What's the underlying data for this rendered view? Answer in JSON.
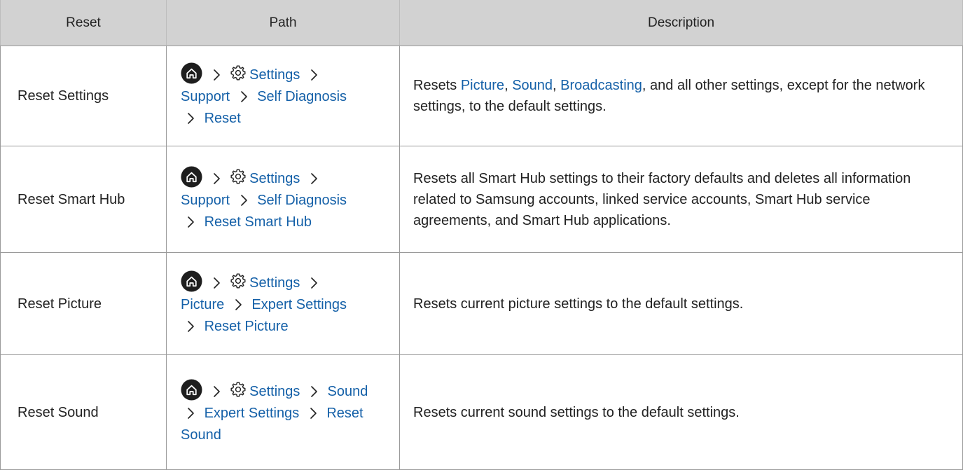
{
  "headers": {
    "reset": "Reset",
    "path": "Path",
    "description": "Description"
  },
  "icons": {
    "home": "home-icon",
    "settings": "gear-icon",
    "separator": "chevron-right-icon"
  },
  "colors": {
    "link": "#1460a8",
    "header_bg": "#d2d2d2",
    "icon_fill": "#1e1e1e"
  },
  "rows": [
    {
      "reset": "Reset Settings",
      "path": {
        "settings": "Settings",
        "p1": "Support",
        "p2": "Self Diagnosis",
        "p3": "Reset"
      },
      "desc": {
        "t1": "Resets ",
        "l1": "Picture",
        "t2": ", ",
        "l2": "Sound",
        "t3": ", ",
        "l3": "Broadcasting",
        "t4": ", and all other settings, except for the network settings, to the default settings."
      }
    },
    {
      "reset": "Reset Smart Hub",
      "path": {
        "settings": "Settings",
        "p1": "Support",
        "p2": "Self Diagnosis",
        "p3": "Reset Smart Hub"
      },
      "desc": "Resets all Smart Hub settings to their factory defaults and deletes all information related to Samsung accounts, linked service accounts, Smart Hub service agreements, and Smart Hub applications."
    },
    {
      "reset": "Reset Picture",
      "path": {
        "settings": "Settings",
        "p1": "Picture",
        "p2": "Expert Settings",
        "p3": "Reset Picture"
      },
      "desc": "Resets current picture settings to the default settings."
    },
    {
      "reset": "Reset Sound",
      "path": {
        "settings": "Settings",
        "p1": "Sound",
        "p2": "Expert Settings",
        "p3a": "Reset",
        "p3b": "Sound"
      },
      "desc": "Resets current sound settings to the default settings."
    }
  ]
}
